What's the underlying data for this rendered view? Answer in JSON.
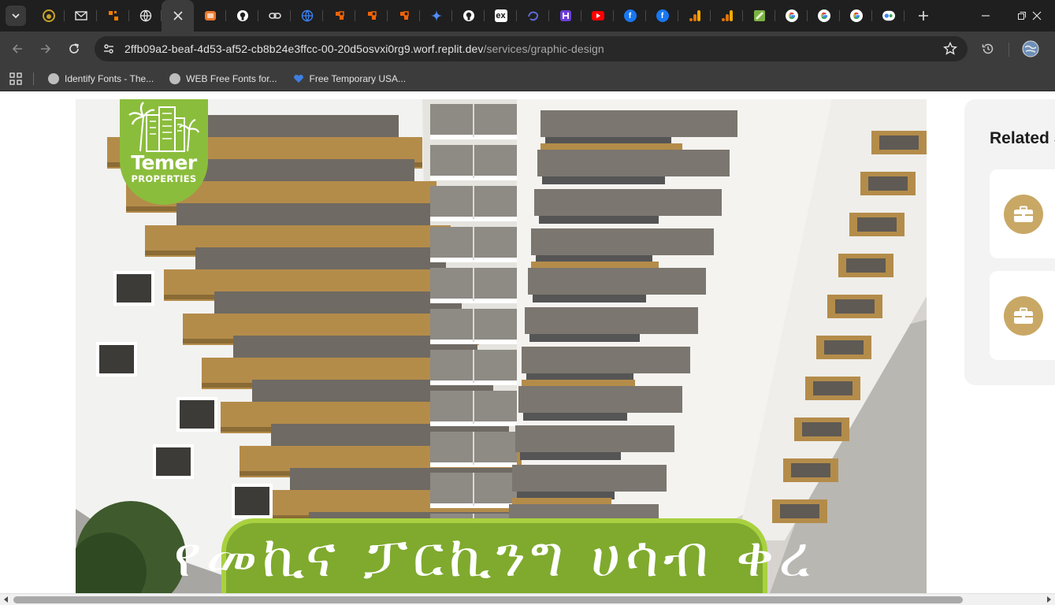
{
  "browser": {
    "tabs": [
      {
        "name": "tab-1",
        "icon": "gold-circle-icon",
        "color": "#c9a227",
        "letter": ""
      },
      {
        "name": "tab-2",
        "icon": "mail-icon",
        "color": "#555555",
        "letter": ""
      },
      {
        "name": "tab-3",
        "icon": "orange-pointer-icon",
        "color": "#f57c00",
        "letter": ""
      },
      {
        "name": "tab-4",
        "icon": "globe-icon",
        "color": "#3a3a3a",
        "letter": ""
      },
      {
        "name": "tab-active",
        "icon": "close-icon",
        "color": "#3c3c3c",
        "letter": ""
      },
      {
        "name": "tab-6",
        "icon": "orange-card-icon",
        "color": "#f0782b",
        "letter": ""
      },
      {
        "name": "tab-7",
        "icon": "github-icon",
        "color": "#ffffff",
        "letter": ""
      },
      {
        "name": "tab-8",
        "icon": "link-icon",
        "color": "#e3e3e3",
        "letter": ""
      },
      {
        "name": "tab-9",
        "icon": "globe-blue-icon",
        "color": "#3b82f6",
        "letter": ""
      },
      {
        "name": "tab-10",
        "icon": "replit-icon",
        "color": "#f26207",
        "letter": ""
      },
      {
        "name": "tab-11",
        "icon": "replit-icon",
        "color": "#f26207",
        "letter": ""
      },
      {
        "name": "tab-12",
        "icon": "replit-icon",
        "color": "#f26207",
        "letter": ""
      },
      {
        "name": "tab-13",
        "icon": "gemini-sparkle-icon",
        "color": "#4f8cf7",
        "letter": ""
      },
      {
        "name": "tab-14",
        "icon": "github-icon",
        "color": "#ffffff",
        "letter": ""
      },
      {
        "name": "tab-15",
        "icon": "ex-icon",
        "color": "#ffffff",
        "letter": "ex"
      },
      {
        "name": "tab-16",
        "icon": "swirl-icon",
        "color": "#5b6bd6",
        "letter": ""
      },
      {
        "name": "tab-17",
        "icon": "hashnode-icon",
        "color": "#6c3ed6",
        "letter": ""
      },
      {
        "name": "tab-18",
        "icon": "youtube-icon",
        "color": "#ff0000",
        "letter": ""
      },
      {
        "name": "tab-19",
        "icon": "facebook-icon",
        "color": "#1877f2",
        "letter": "f"
      },
      {
        "name": "tab-20",
        "icon": "facebook-icon",
        "color": "#1877f2",
        "letter": "f"
      },
      {
        "name": "tab-21",
        "icon": "analytics-icon",
        "color": "#f9ab00",
        "letter": ""
      },
      {
        "name": "tab-22",
        "icon": "analytics-icon",
        "color": "#f9ab00",
        "letter": ""
      },
      {
        "name": "tab-23",
        "icon": "android-icon",
        "color": "#7cb342",
        "letter": ""
      },
      {
        "name": "tab-24",
        "icon": "google-icon",
        "color": "#ffffff",
        "letter": "G"
      },
      {
        "name": "tab-25",
        "icon": "google-icon",
        "color": "#ffffff",
        "letter": "G"
      },
      {
        "name": "tab-26",
        "icon": "google-icon",
        "color": "#ffffff",
        "letter": "G"
      },
      {
        "name": "tab-27",
        "icon": "google-lens-icon",
        "color": "#ffffff",
        "letter": ""
      }
    ],
    "url_host": "2ffb09a2-beaf-4d53-af52-cb8b24e3ffcc-00-20d5osvxi0rg9.worf.replit.dev",
    "url_path": "/services/graphic-design",
    "bookmarks": [
      {
        "label": "Identify Fonts - The...",
        "icon": "globe-icon"
      },
      {
        "label": "WEB Free Fonts for...",
        "icon": "globe-icon"
      },
      {
        "label": "Free Temporary USA...",
        "icon": "heart-icon"
      }
    ]
  },
  "page": {
    "logo": {
      "name": "Temer",
      "sub": "PROPERTIES"
    },
    "banner_text": "የመኪና ፓርኪንግ ሀሳብ ቀረ",
    "related_title": "Related S",
    "related_cards": [
      {
        "icon": "briefcase-icon"
      },
      {
        "icon": "briefcase-icon"
      }
    ],
    "colors": {
      "accent_gold": "#c9a865",
      "logo_green": "#8bbd3c",
      "banner_green": "#7faa2e",
      "balcony_brown": "#b48c4a"
    }
  }
}
